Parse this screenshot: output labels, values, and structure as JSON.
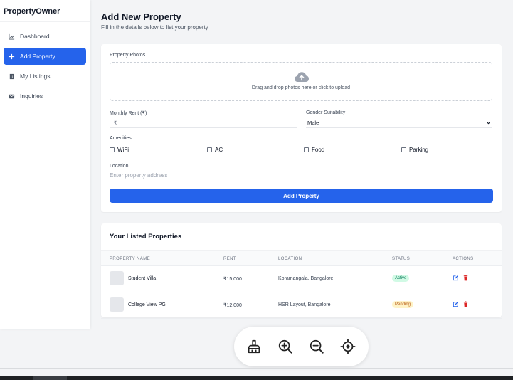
{
  "sidebar": {
    "brand": "PropertyOwner",
    "items": [
      {
        "label": "Dashboard",
        "icon": "chart-line-icon",
        "active": false
      },
      {
        "label": "Add Property",
        "icon": "plus-icon",
        "active": true
      },
      {
        "label": "My Listings",
        "icon": "building-icon",
        "active": false
      },
      {
        "label": "Inquiries",
        "icon": "envelope-icon",
        "active": false
      }
    ]
  },
  "header": {
    "title": "Add New Property",
    "subtitle": "Fill in the details below to list your property"
  },
  "form": {
    "photos_label": "Property Photos",
    "dropzone_text": "Drag and drop photos here or click to upload",
    "dropzone_icon": "cloud-upload-icon",
    "rent_label": "Monthly Rent (₹)",
    "rent_prefix": "₹",
    "rent_value": "",
    "gender_label": "Gender Suitability",
    "gender_value": "Male",
    "amenities_label": "Amenities",
    "amenities": [
      "WiFi",
      "AC",
      "Food",
      "Parking"
    ],
    "location_label": "Location",
    "location_placeholder": "Enter property address",
    "submit_label": "Add Property"
  },
  "listings": {
    "title": "Your Listed Properties",
    "columns": [
      "PROPERTY NAME",
      "RENT",
      "LOCATION",
      "STATUS",
      "ACTIONS"
    ],
    "rows": [
      {
        "name": "Student Villa",
        "rent": "₹15,000",
        "location": "Koramangala, Bangalore",
        "status": "Active"
      },
      {
        "name": "College View PG",
        "rent": "₹12,000",
        "location": "HSR Layout, Bangalore",
        "status": "Pending"
      }
    ]
  },
  "toolbar": {
    "tools": [
      "broom-icon",
      "zoom-in-icon",
      "zoom-out-icon",
      "locate-icon"
    ]
  },
  "colors": {
    "accent": "#2563eb",
    "active_badge_bg": "#d1fae5",
    "active_badge_text": "#047857",
    "pending_badge_bg": "#fef3c7",
    "pending_badge_text": "#b45309",
    "delete": "#dc2626"
  }
}
